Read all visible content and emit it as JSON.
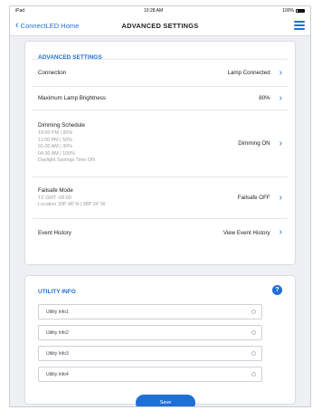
{
  "status_bar": {
    "carrier": "iPad",
    "time": "10:28 AM",
    "battery": "100%"
  },
  "nav": {
    "back_label": "ConnectLED Home",
    "title": "ADVANCED SETTINGS"
  },
  "advanced": {
    "section_title": "ADVANCED SETTINGS",
    "rows": [
      {
        "label": "Connection",
        "value": "Lamp Connected"
      },
      {
        "label": "Maximum Lamp Brightness",
        "value": "80%"
      },
      {
        "label": "Dimming Schedule",
        "value": "Dimming ON",
        "details": [
          "10:00 PM | 80%",
          "11:00 PM | 50%",
          "01:00 AM | 30%",
          "04:30 AM | 100%",
          "Daylight Savings Time ON"
        ]
      },
      {
        "label": "Failsafe Mode",
        "value": "Failsafe OFF",
        "details": [
          "TZ GMT -08:00",
          "Location 39P 48' N | 98P 34' W"
        ]
      },
      {
        "label": "Event History",
        "value": "View Event History"
      }
    ]
  },
  "utility": {
    "section_title": "UTILITY INFO",
    "help_symbol": "?",
    "fields": [
      "Utility Info1",
      "Utility Info2",
      "Utility Info3",
      "Utility Info4"
    ],
    "save_label": "Save"
  },
  "colors": {
    "accent": "#1f6fd6",
    "background": "#eef0f3"
  }
}
